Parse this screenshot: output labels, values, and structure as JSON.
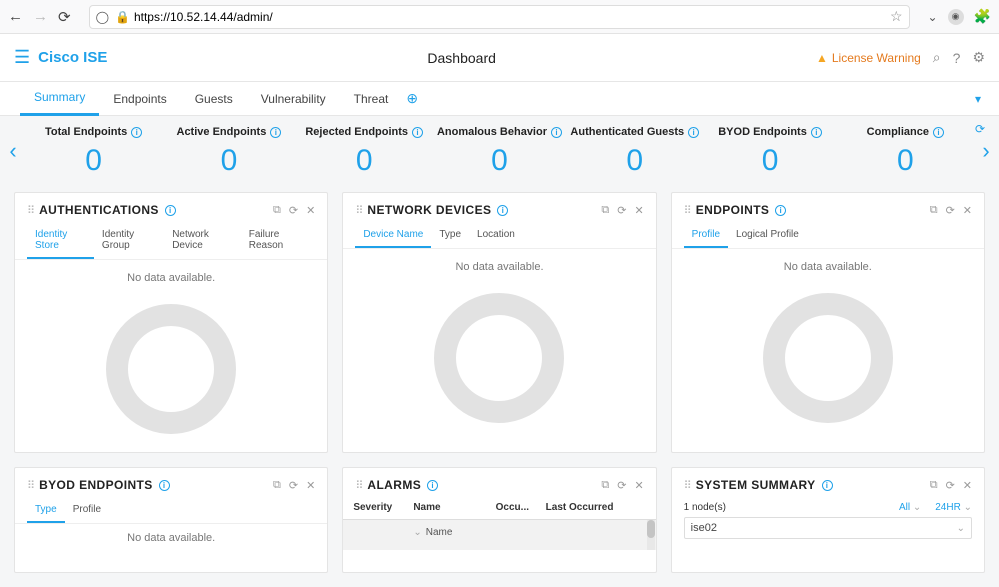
{
  "browser": {
    "url": "https://10.52.14.44/admin/"
  },
  "app": {
    "brand": "Cisco ISE",
    "page_title": "Dashboard",
    "warning": "License Warning"
  },
  "tabs": [
    {
      "label": "Summary",
      "active": true
    },
    {
      "label": "Endpoints",
      "active": false
    },
    {
      "label": "Guests",
      "active": false
    },
    {
      "label": "Vulnerability",
      "active": false
    },
    {
      "label": "Threat",
      "active": false
    }
  ],
  "kpis": [
    {
      "label": "Total Endpoints",
      "value": "0"
    },
    {
      "label": "Active Endpoints",
      "value": "0"
    },
    {
      "label": "Rejected Endpoints",
      "value": "0"
    },
    {
      "label": "Anomalous Behavior",
      "value": "0"
    },
    {
      "label": "Authenticated Guests",
      "value": "0"
    },
    {
      "label": "BYOD Endpoints",
      "value": "0"
    },
    {
      "label": "Compliance",
      "value": "0"
    }
  ],
  "cards": {
    "auth": {
      "title": "AUTHENTICATIONS",
      "tabs": [
        "Identity Store",
        "Identity Group",
        "Network Device",
        "Failure Reason"
      ],
      "active_tab": 0,
      "nodata": "No data available."
    },
    "netdev": {
      "title": "NETWORK DEVICES",
      "tabs": [
        "Device Name",
        "Type",
        "Location"
      ],
      "active_tab": 0,
      "nodata": "No data available."
    },
    "endpoints": {
      "title": "ENDPOINTS",
      "tabs": [
        "Profile",
        "Logical Profile"
      ],
      "active_tab": 0,
      "nodata": "No data available."
    },
    "byod": {
      "title": "BYOD ENDPOINTS",
      "tabs": [
        "Type",
        "Profile"
      ],
      "active_tab": 0,
      "nodata": "No data available."
    },
    "alarms": {
      "title": "ALARMS",
      "columns": [
        "Severity",
        "Name",
        "Occu...",
        "Last Occurred"
      ],
      "sort_col": "Name"
    },
    "sys": {
      "title": "SYSTEM SUMMARY",
      "nodes_label": "1 node(s)",
      "filter_all": "All",
      "filter_time": "24HR",
      "selected_node": "ise02"
    }
  }
}
